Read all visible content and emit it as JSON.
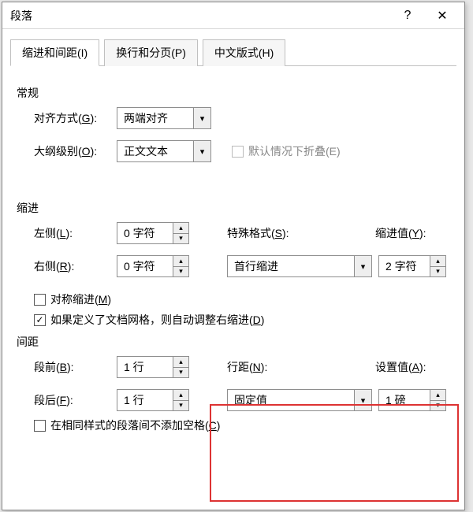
{
  "title": "段落",
  "titlebar": {
    "help": "?",
    "close": "✕"
  },
  "tabs": {
    "indent": "缩进和间距(I)",
    "breaks": "换行和分页(P)",
    "cjk": "中文版式(H)"
  },
  "section": {
    "general": "常规",
    "indent": "缩进",
    "spacing": "间距"
  },
  "general": {
    "align_label": "对齐方式(G):",
    "align_value": "两端对齐",
    "outline_label": "大纲级别(O):",
    "outline_value": "正文文本",
    "collapse_label": "默认情况下折叠(E)"
  },
  "indent": {
    "left_label": "左侧(L):",
    "left_value": "0 字符",
    "right_label": "右侧(R):",
    "right_value": "0 字符",
    "special_label": "特殊格式(S):",
    "special_value": "首行缩进",
    "by_label": "缩进值(Y):",
    "by_value": "2 字符",
    "mirror_label": "对称缩进(M)",
    "grid_label": "如果定义了文档网格，则自动调整右缩进(D)"
  },
  "spacing": {
    "before_label": "段前(B):",
    "before_value": "1 行",
    "after_label": "段后(F):",
    "after_value": "1 行",
    "line_label": "行距(N):",
    "line_value": "固定值",
    "at_label": "设置值(A):",
    "at_value": "1 磅",
    "nospace_label": "在相同样式的段落间不添加空格(C)"
  }
}
